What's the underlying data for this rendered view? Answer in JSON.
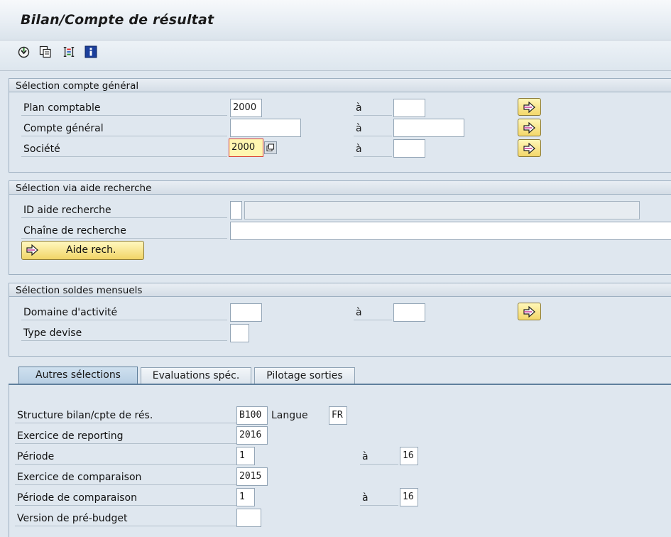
{
  "window": {
    "title": "Bilan/Compte de résultat"
  },
  "toolbar": {
    "icons": [
      "execute-icon",
      "variant-icon",
      "selection-options-icon",
      "info-icon"
    ]
  },
  "group1": {
    "header": "Sélection compte général",
    "rows": [
      {
        "label": "Plan comptable",
        "from": "2000",
        "to_label": "à",
        "to": ""
      },
      {
        "label": "Compte général",
        "from": "",
        "to_label": "à",
        "to": ""
      },
      {
        "label": "Société",
        "from": "2000",
        "to_label": "à",
        "to": ""
      }
    ]
  },
  "group2": {
    "header": "Sélection via aide recherche",
    "id_label": "ID aide recherche",
    "id_value": "",
    "id_desc": "",
    "chain_label": "Chaîne de recherche",
    "chain_value": "",
    "button_label": "Aide rech."
  },
  "group3": {
    "header": "Sélection soldes mensuels",
    "rows": [
      {
        "label": "Domaine d'activité",
        "from": "",
        "to_label": "à",
        "to": ""
      },
      {
        "label": "Type devise",
        "from": ""
      }
    ]
  },
  "tabs": [
    {
      "label": "Autres sélections",
      "active": true
    },
    {
      "label": "Evaluations spéc.",
      "active": false
    },
    {
      "label": "Pilotage sorties",
      "active": false
    }
  ],
  "tab_content": {
    "structure_label": "Structure bilan/cpte de rés.",
    "structure_value": "B100",
    "langue_label": "Langue",
    "langue_value": "FR",
    "exercice_label": "Exercice de reporting",
    "exercice_value": "2016",
    "periode_label": "Période",
    "periode_from": "1",
    "periode_to_label": "à",
    "periode_to": "16",
    "comp_exercice_label": "Exercice de comparaison",
    "comp_exercice_value": "2015",
    "comp_periode_label": "Période de comparaison",
    "comp_periode_from": "1",
    "comp_periode_to_label": "à",
    "comp_periode_to": "16",
    "version_label": "Version de pré-budget",
    "version_value": ""
  },
  "colors": {
    "background": "#dfe7ef",
    "button_yellow": "#f3d76a",
    "required_border": "#d9403a",
    "tab_active": "#b6cde2"
  }
}
